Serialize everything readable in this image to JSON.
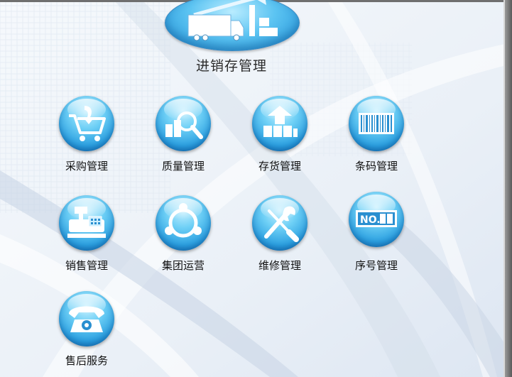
{
  "header": {
    "title": "进销存管理",
    "icon": "delivery-truck-warehouse-icon"
  },
  "modules": [
    {
      "label": "采购管理",
      "icon": "shopping-cart-icon"
    },
    {
      "label": "质量管理",
      "icon": "magnifier-inspection-icon"
    },
    {
      "label": "存货管理",
      "icon": "warehouse-icon"
    },
    {
      "label": "条码管理",
      "icon": "barcode-icon"
    },
    {
      "label": "销售管理",
      "icon": "cash-register-icon"
    },
    {
      "label": "集团运营",
      "icon": "group-network-icon"
    },
    {
      "label": "维修管理",
      "icon": "wrench-screwdriver-icon"
    },
    {
      "label": "序号管理",
      "icon": "serial-number-icon",
      "serial_text": "NO."
    },
    {
      "label": "售后服务",
      "icon": "telephone-icon"
    }
  ],
  "colors": {
    "accent": "#2a9fe0",
    "accent_dark": "#1677bf",
    "text": "#111111"
  }
}
